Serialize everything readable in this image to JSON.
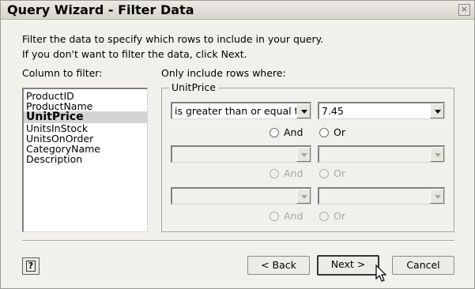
{
  "window": {
    "title": "Query Wizard - Filter Data",
    "close_glyph": "×"
  },
  "instructions": {
    "line1": "Filter the data to specify which rows to include in your query.",
    "line2": "If you don't want to filter the data, click Next."
  },
  "column_panel": {
    "label": "Column to filter:",
    "items": [
      "ProductID",
      "ProductName",
      "UnitPrice",
      "UnitsInStock",
      "UnitsOnOrder",
      "CategoryName",
      "Description"
    ],
    "selected": "UnitPrice"
  },
  "criteria_panel": {
    "label": "Only include rows where:",
    "group_title": "UnitPrice",
    "row1": {
      "operator": "is greater than or equal to",
      "value": "7.45"
    },
    "row2": {
      "operator": "",
      "value": ""
    },
    "row3": {
      "operator": "",
      "value": ""
    },
    "and_label": "And",
    "or_label": "Or"
  },
  "buttons": {
    "back": "< Back",
    "next": "Next >",
    "cancel": "Cancel",
    "help": "?"
  }
}
